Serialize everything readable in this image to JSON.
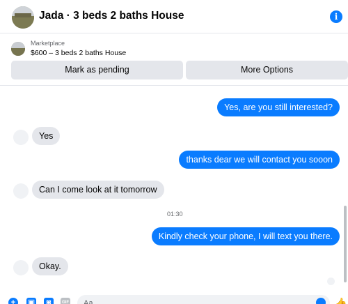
{
  "header": {
    "title": "Jada · 3 beds 2 baths House",
    "info_icon": "i"
  },
  "marketplace": {
    "label": "Marketplace",
    "listing": "$600 – 3 beds 2 baths House",
    "pending_button": "Mark as pending",
    "more_button": "More Options"
  },
  "messages": [
    {
      "sender": "me",
      "text": "Yes, are you still interested?"
    },
    {
      "sender": "them",
      "text": "Yes"
    },
    {
      "sender": "me",
      "text": "thanks dear we will contact you sooon"
    },
    {
      "sender": "them",
      "text": "Can I come look at it tomorrow"
    },
    {
      "sender": "me",
      "text": "Kindly check your phone, I will text you there."
    },
    {
      "sender": "them",
      "text": "Okay."
    }
  ],
  "timestamp": "01:30",
  "composer": {
    "placeholder": "Aa",
    "icons": [
      "plus-icon",
      "image-icon",
      "sticker-icon",
      "gif-icon",
      "emoji-icon",
      "thumbs-up-icon"
    ]
  },
  "colors": {
    "accent": "#0a7cff",
    "incoming": "#e4e6eb"
  }
}
